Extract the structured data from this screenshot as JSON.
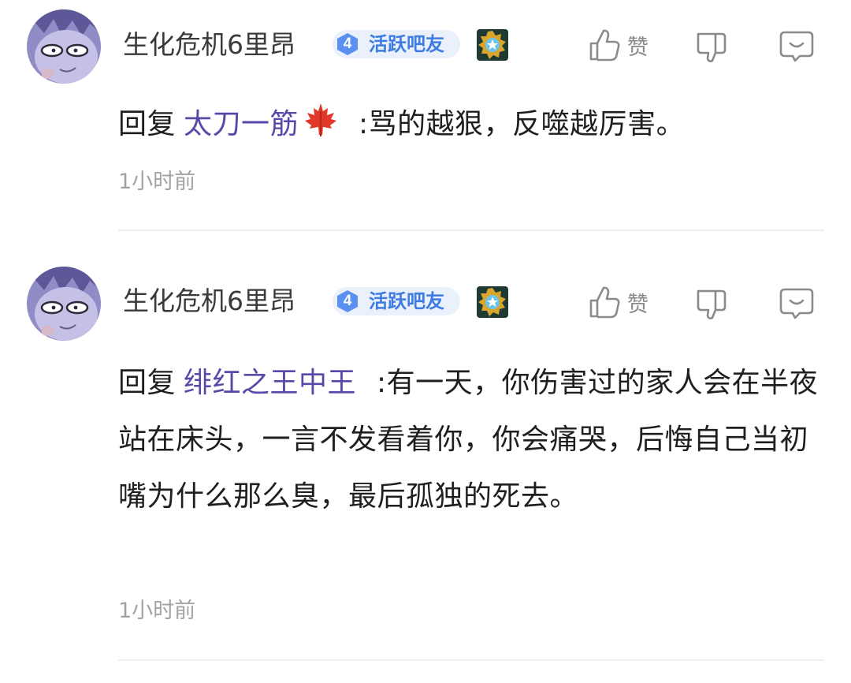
{
  "comments": [
    {
      "username": "生化危机6里昂",
      "level": "4",
      "level_title": "活跃吧友",
      "like_label": "赞",
      "reply_prefix": "回复",
      "mention": "太刀一筋",
      "mention_has_leaf": true,
      "text": ":骂的越狠，反噬越厉害。",
      "time": "1小时前"
    },
    {
      "username": "生化危机6里昂",
      "level": "4",
      "level_title": "活跃吧友",
      "like_label": "赞",
      "reply_prefix": "回复",
      "mention": "绯红之王中王",
      "mention_has_leaf": false,
      "text": ":有一天，你伤害过的家人会在半夜站在床头，一言不发看着你，你会痛哭，后悔自己当初嘴为什么那么臭，最后孤独的死去。",
      "time": "1小时前"
    }
  ],
  "icons": {
    "like": "thumbs-up-icon",
    "dislike": "thumbs-down-icon",
    "reply": "comment-bubble-icon",
    "medal": "star-medal-icon",
    "mention_decoration": "maple-leaf-icon"
  },
  "colors": {
    "mention": "#5a48a8",
    "level_badge_bg": "#eaf1fb",
    "level_title": "#3e7be3",
    "timestamp": "#a3a3a3",
    "action_icon": "#8a8a8a"
  }
}
